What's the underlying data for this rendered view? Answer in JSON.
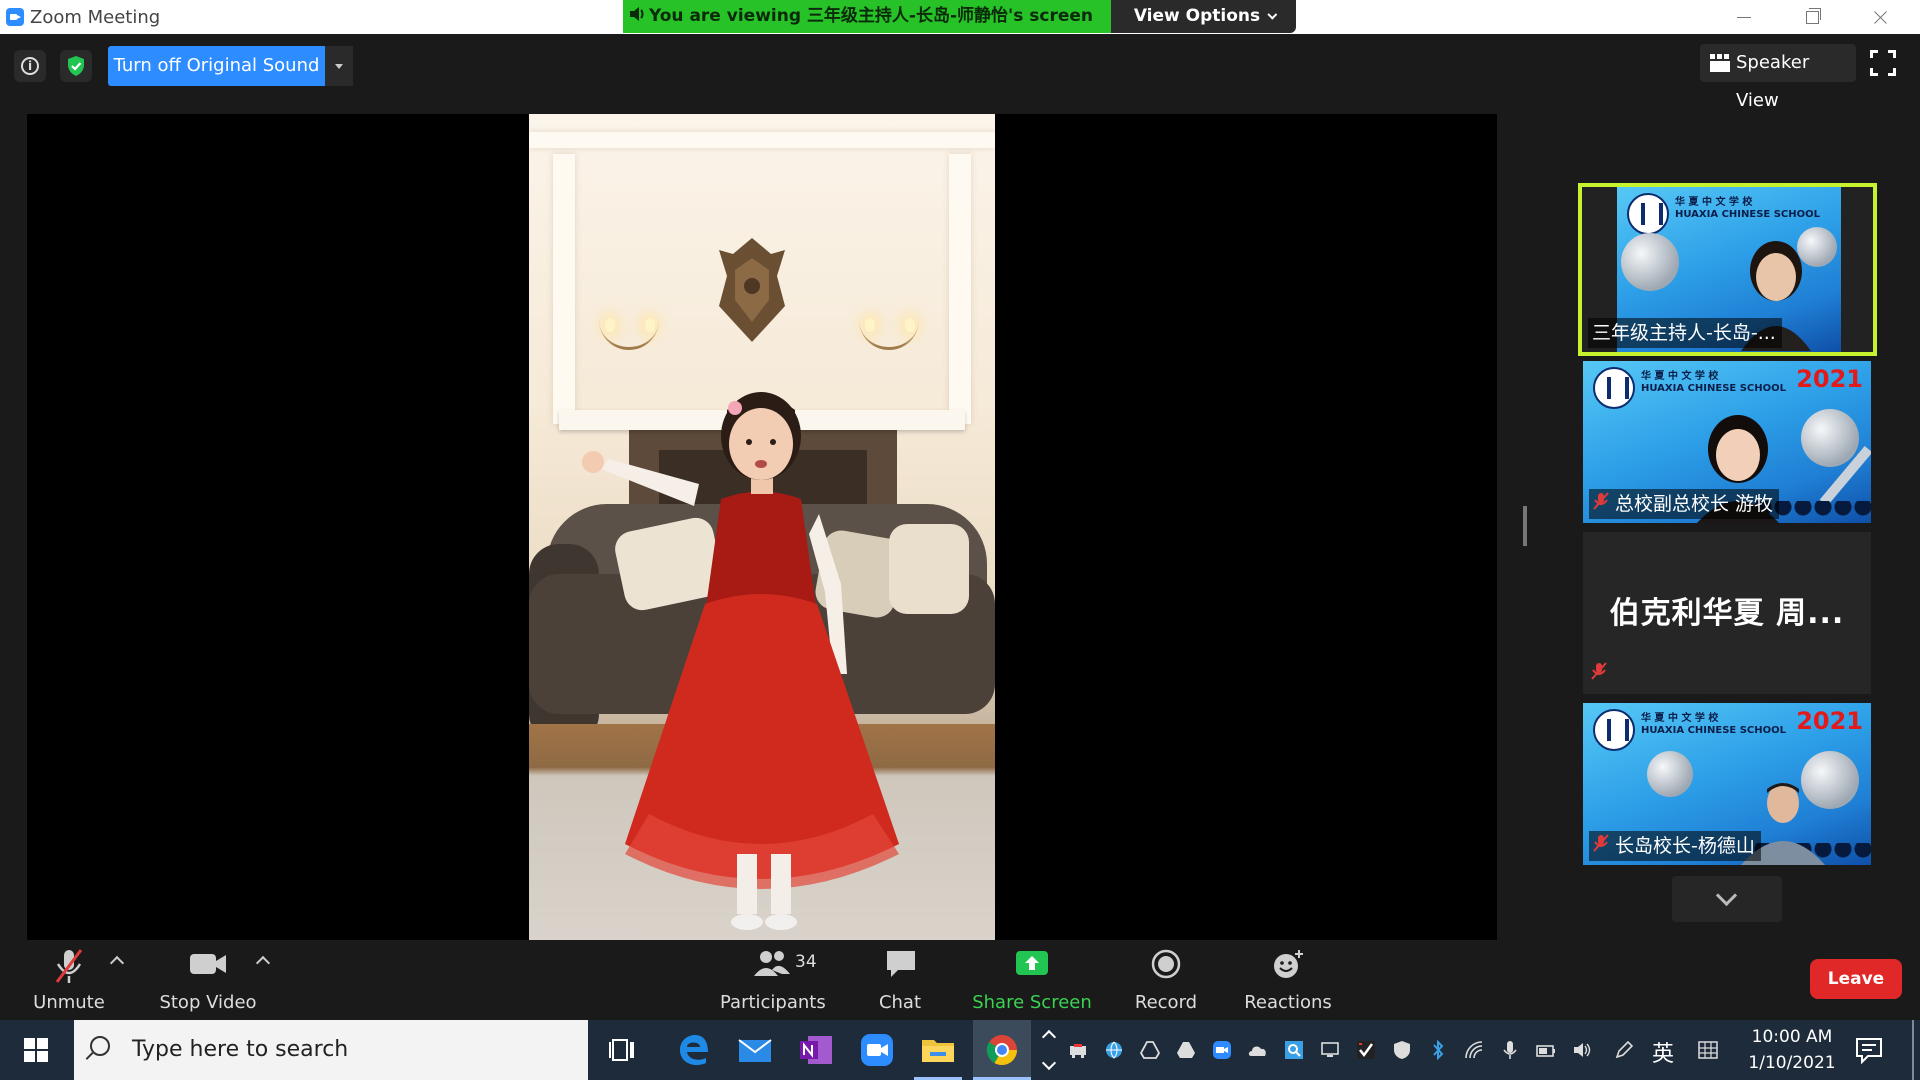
{
  "window": {
    "title": "Zoom Meeting",
    "viewing_banner": "You are viewing 三年级主持人-长岛-师静怡's screen",
    "view_options": "View Options"
  },
  "topbar": {
    "original_sound_label": "Turn off Original Sound",
    "view_label": "Speaker View"
  },
  "thumbnails": {
    "school_line1": "华 夏 中 文 学 校",
    "school_line2": "HUAXIA CHINESE SCHOOL",
    "year": "2021",
    "items": [
      {
        "name": "三年级主持人-长岛-...",
        "active_speaker": true
      },
      {
        "name": "总校副总校长 游牧",
        "muted": true
      },
      {
        "display_name": "伯克利华夏 周...",
        "muted": true
      },
      {
        "name": "长岛校长-杨德山",
        "muted": true
      }
    ]
  },
  "controls": {
    "unmute": "Unmute",
    "stop_video": "Stop Video",
    "participants": "Participants",
    "participants_count": "34",
    "chat": "Chat",
    "share_screen": "Share Screen",
    "record": "Record",
    "reactions": "Reactions",
    "leave": "Leave"
  },
  "taskbar": {
    "search_placeholder": "Type here to search",
    "ime": "英",
    "time": "10:00 AM",
    "date": "1/10/2021",
    "pinned_icons": [
      "task-view-icon",
      "edge-icon",
      "mail-icon",
      "onenote-icon",
      "zoom-icon",
      "file-explorer-icon",
      "chrome-icon"
    ]
  },
  "colors": {
    "zoom_blue": "#2d8cff",
    "banner_green": "#27c227",
    "active_speaker_border": "#c6f22e",
    "leave_red": "#e02828",
    "share_green": "#39d353"
  }
}
